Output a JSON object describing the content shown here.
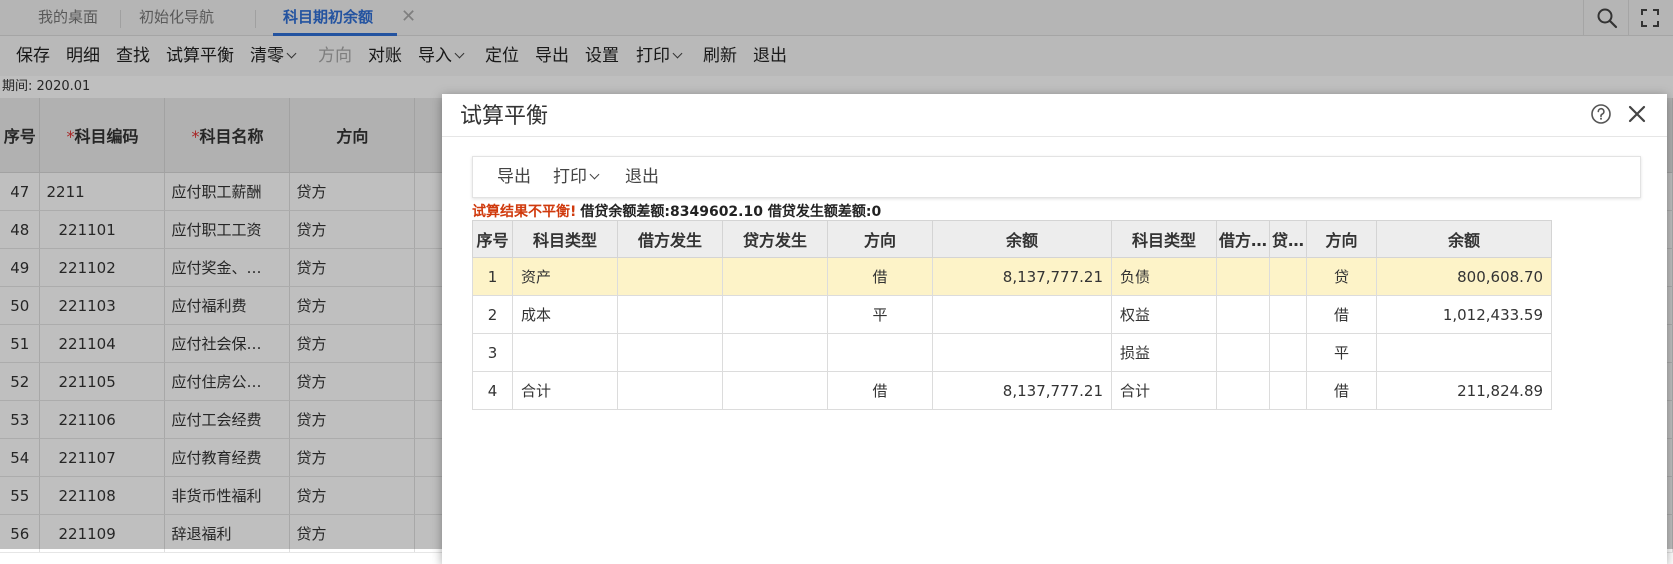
{
  "tabs": [
    {
      "label": "我的桌面"
    },
    {
      "label": "初始化导航"
    },
    {
      "label": "科目期初余额",
      "active": true
    }
  ],
  "tab_icons": {
    "search": "search-icon",
    "fullscreen": "fullscreen-icon",
    "close": "close-icon"
  },
  "toolbar": {
    "save": "保存",
    "detail": "明细",
    "find": "查找",
    "trial_balance": "试算平衡",
    "clear": "清零",
    "direction": "方向",
    "reconcile": "对账",
    "import": "导入",
    "locate": "定位",
    "export": "导出",
    "settings": "设置",
    "print": "打印",
    "refresh": "刷新",
    "exit": "退出"
  },
  "period": {
    "label": "期间:",
    "value": "2020.01"
  },
  "grid": {
    "headers": {
      "seq": "序号",
      "code": "科目编码",
      "name": "科目名称",
      "direction": "方向"
    },
    "required_mark": "*",
    "rows": [
      {
        "seq": "47",
        "code": "2211",
        "name": "应付职工薪酬",
        "direction": "贷方"
      },
      {
        "seq": "48",
        "code": "221101",
        "name": "应付职工工资",
        "direction": "贷方"
      },
      {
        "seq": "49",
        "code": "221102",
        "name": "应付奖金、…",
        "direction": "贷方"
      },
      {
        "seq": "50",
        "code": "221103",
        "name": "应付福利费",
        "direction": "贷方"
      },
      {
        "seq": "51",
        "code": "221104",
        "name": "应付社会保…",
        "direction": "贷方"
      },
      {
        "seq": "52",
        "code": "221105",
        "name": "应付住房公…",
        "direction": "贷方"
      },
      {
        "seq": "53",
        "code": "221106",
        "name": "应付工会经费",
        "direction": "贷方"
      },
      {
        "seq": "54",
        "code": "221107",
        "name": "应付教育经费",
        "direction": "贷方"
      },
      {
        "seq": "55",
        "code": "221108",
        "name": "非货币性福利",
        "direction": "贷方"
      },
      {
        "seq": "56",
        "code": "221109",
        "name": "辞退福利",
        "direction": "贷方"
      }
    ]
  },
  "dialog": {
    "title": "试算平衡",
    "toolbar": {
      "export": "导出",
      "print": "打印",
      "exit": "退出"
    },
    "result": {
      "status": "试算结果不平衡!",
      "diff": "借贷余额差额:8349602.10 借贷发生额差额:0"
    },
    "table": {
      "headers": [
        "序号",
        "科目类型",
        "借方发生",
        "贷方发生",
        "方向",
        "余额",
        "科目类型",
        "借方…",
        "贷…",
        "方向",
        "余额"
      ],
      "rows": [
        {
          "seq": "1",
          "type1": "资产",
          "debit": "",
          "credit": "",
          "dir1": "借",
          "bal1": "8,137,777.21",
          "type2": "负债",
          "debit2": "",
          "credit2": "",
          "dir2": "贷",
          "bal2": "800,608.70"
        },
        {
          "seq": "2",
          "type1": "成本",
          "debit": "",
          "credit": "",
          "dir1": "平",
          "bal1": "",
          "type2": "权益",
          "debit2": "",
          "credit2": "",
          "dir2": "借",
          "bal2": "1,012,433.59"
        },
        {
          "seq": "3",
          "type1": "",
          "debit": "",
          "credit": "",
          "dir1": "",
          "bal1": "",
          "type2": "损益",
          "debit2": "",
          "credit2": "",
          "dir2": "平",
          "bal2": ""
        },
        {
          "seq": "4",
          "type1": "合计",
          "debit": "",
          "credit": "",
          "dir1": "借",
          "bal1": "8,137,777.21",
          "type2": "合计",
          "debit2": "",
          "credit2": "",
          "dir2": "借",
          "bal2": "211,824.89"
        }
      ]
    }
  },
  "colors": {
    "accent": "#2f6fd6",
    "warning": "#d03a0d",
    "highlight_row": "#fdf3c8"
  }
}
